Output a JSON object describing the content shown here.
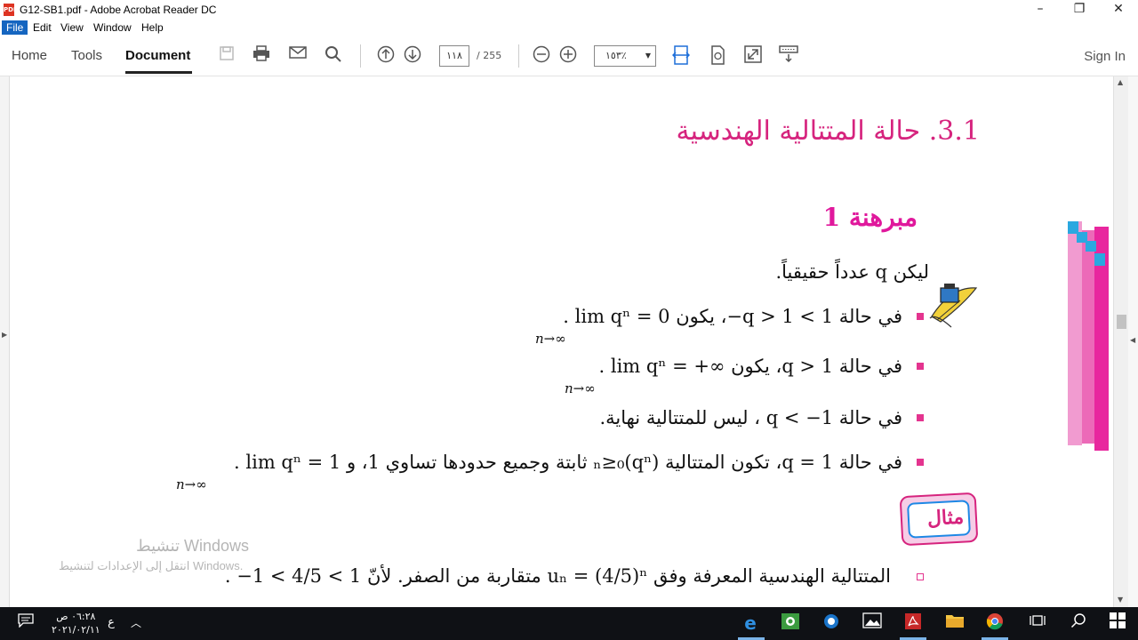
{
  "window": {
    "title": "G12-SB1.pdf - Adobe Acrobat Reader DC",
    "min_glyph": "–",
    "max_glyph": "❐",
    "close_glyph": "✕"
  },
  "menu": [
    "File",
    "Edit",
    "View",
    "Window",
    "Help"
  ],
  "tabs": {
    "home": "Home",
    "tools": "Tools",
    "document": "Document"
  },
  "toolbar": {
    "page_current": "١١٨",
    "page_total": "/ 255",
    "zoom": "١٥٣٪",
    "sign_in": "Sign In"
  },
  "icons": {
    "save": "save-icon",
    "print": "print-icon",
    "email": "email-icon",
    "search": "search-icon",
    "prev": "arrow-up-icon",
    "next": "arrow-down-icon",
    "zoom_out": "zoom-out-icon",
    "zoom_in": "zoom-in-icon"
  },
  "content": {
    "heading": "3.1. حالة المتتالية الهندسية",
    "theorem_title": "مبرهنة 1",
    "intro": "ليكن  q  عدداً حقيقياً.",
    "items": [
      {
        "text": "في حالة  1 > q > 1−، يكون  0 = lim qⁿ .",
        "sub": "n→∞"
      },
      {
        "text": "في حالة  q > 1، يكون  ∞+ = lim qⁿ .",
        "sub": "n→∞"
      },
      {
        "text": "في حالة  1− > q ، ليس للمتتالية نهاية.",
        "sub": ""
      },
      {
        "text": "في حالة  q = 1، تكون المتتالية  (qⁿ)ₙ≥₀ ثابتة وجميع حدودها تساوي 1، و 1 = lim qⁿ .",
        "sub": "n→∞"
      }
    ],
    "example_label": "مثال",
    "example_text": "المتتالية الهندسية المعرفة وفق  uₙ = (4/5)ⁿ  متقاربة من الصفر. لأنّ  1 > 4/5 > 1− ."
  },
  "watermark": {
    "line1": "تنشيط Windows",
    "line2": "انتقل إلى الإعدادات لتنشيط Windows."
  },
  "taskbar": {
    "time": "٠٦:٢٨ ص",
    "date": "٢٠٢١/٠٢/١١",
    "lang": "ع"
  },
  "colors": {
    "accent": "#d6247e",
    "menu_active": "#1565c0",
    "taskbar": "#0f1115"
  }
}
